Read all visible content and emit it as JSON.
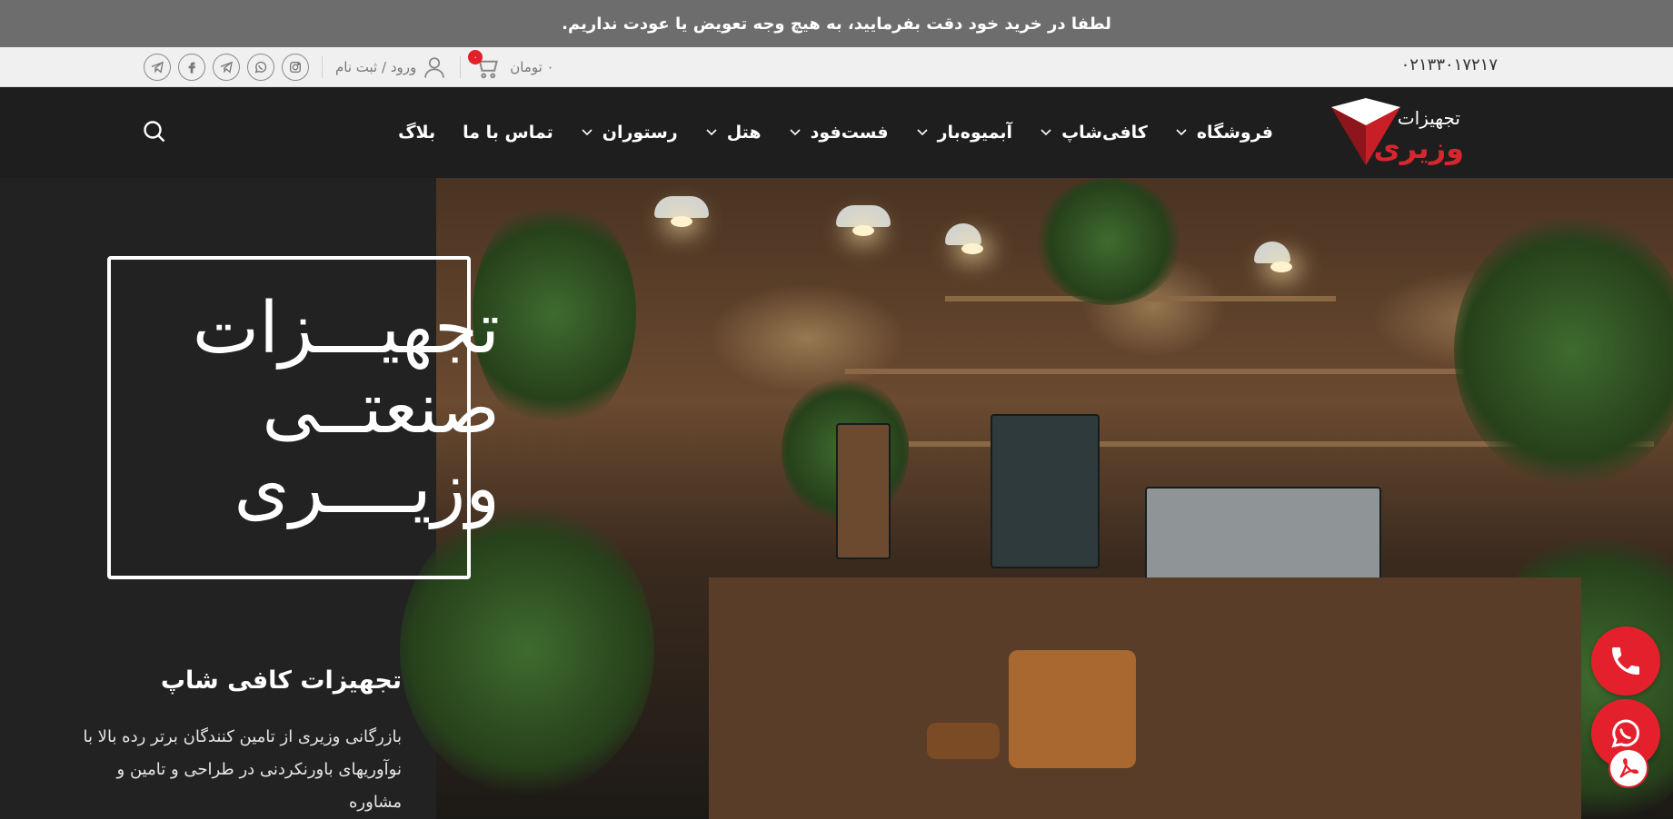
{
  "notice": {
    "text": "لطفا در خرید خود دقت بفرمایید، به هیچ وجه تعویض یا عودت نداریم."
  },
  "topbar": {
    "phone": "۰۲۱۳۳۰۱۷۲۱۷",
    "login_label": "ورود / ثبت نام",
    "cart_total": "۰ تومان",
    "cart_count": "۰",
    "social_icons": [
      "telegram-icon",
      "facebook-icon",
      "telegram-icon",
      "whatsapp-icon",
      "instagram-icon"
    ]
  },
  "logo": {
    "line1": "تجهیزات",
    "line2": "وزیری"
  },
  "nav": {
    "items": [
      {
        "label": "فروشگاه",
        "has_dropdown": true
      },
      {
        "label": "کافی‌شاپ",
        "has_dropdown": true
      },
      {
        "label": "آبمیوه‌بار",
        "has_dropdown": true
      },
      {
        "label": "فست‌فود",
        "has_dropdown": true
      },
      {
        "label": "هتل",
        "has_dropdown": true
      },
      {
        "label": "رستوران",
        "has_dropdown": true
      },
      {
        "label": "تماس با ما",
        "has_dropdown": false
      },
      {
        "label": "بلاگ",
        "has_dropdown": false
      }
    ]
  },
  "hero": {
    "title_line1": "تجهیـــزات",
    "title_line2": "صنعتــی",
    "title_line3": "وزیــــری",
    "subtitle": "تجهیزات کافی شاپ",
    "description": "بازرگانی وزیری از تامین کنندگان برتر رده بالا با نوآوریهای باورنکردنی در طراحی و تامین و مشاوره"
  },
  "colors": {
    "accent": "#e5202d",
    "notice_bg": "#6d6d6d",
    "nav_bg": "#1e1e1e",
    "topbar_bg": "#f0f0f0"
  }
}
